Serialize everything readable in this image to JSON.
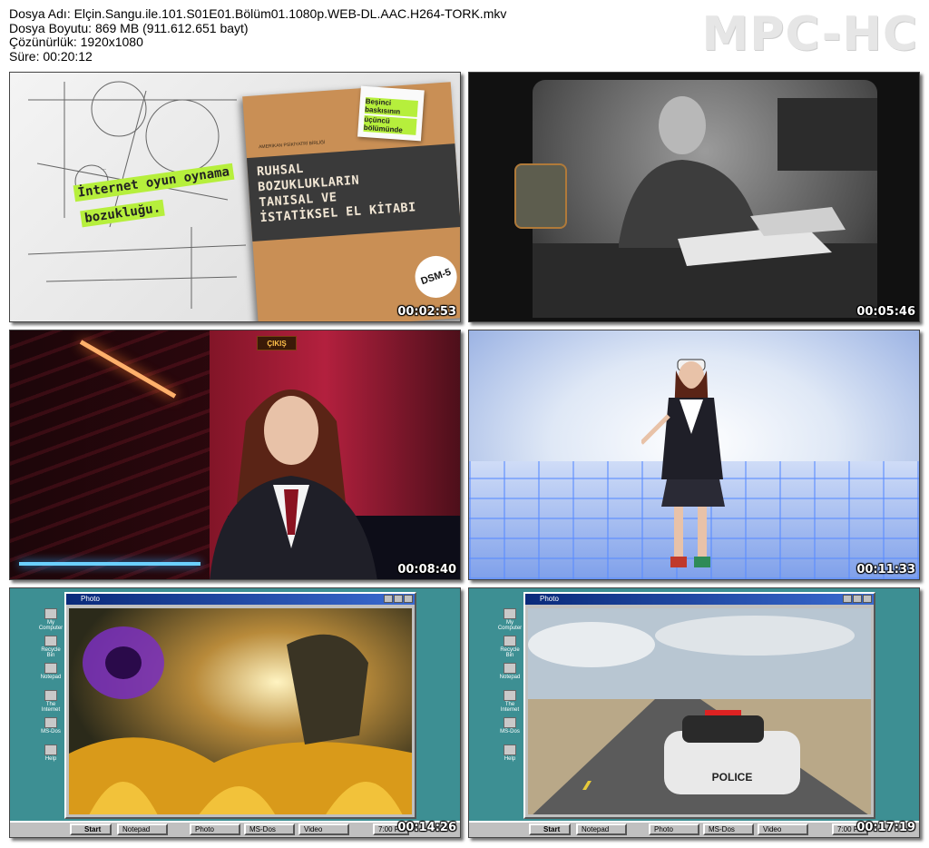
{
  "file_info": {
    "name_line": "Dosya Adı: Elçin.Sangu.ile.101.S01E01.Bölüm01.1080p.WEB-DL.AAC.H264-TORK.mkv",
    "size_line": "Dosya Boyutu: 869 MB (911.612.651 bayt)",
    "resolution_line": "Çözünürlük: 1920x1080",
    "duration_line": "Süre: 00:20:12"
  },
  "logo": "MPC-HC",
  "thumbnails": [
    {
      "timestamp": "00:02:53",
      "sticker_line1": "İnternet oyun oynama",
      "sticker_line2": "bozukluğu.",
      "book_publisher": "AMERİKAN PSİKİYATRİ BİRLİĞİ",
      "book_title_1": "RUHSAL",
      "book_title_2": "BOZUKLUKLARIN",
      "book_title_3": "TANISAL VE",
      "book_title_4": "İSTATİKSEL EL KİTABI",
      "note_line1": "Beşinci baskısının",
      "note_line2": "üçüncü bölümünde",
      "badge": "DSM-5"
    },
    {
      "timestamp": "00:05:46"
    },
    {
      "timestamp": "00:08:40",
      "sign": "ÇIKIŞ"
    },
    {
      "timestamp": "00:11:33"
    },
    {
      "timestamp": "00:14:26",
      "window_title": "Photo",
      "start_label": "Start",
      "task_1": "Notepad",
      "task_2": "Photo",
      "task_3": "MS-Dos",
      "task_4": "Video",
      "clock": "7:00 PM",
      "desktop_icons": [
        "My Computer",
        "Recycle Bin",
        "Notepad",
        "The Internet",
        "MS-Dos",
        "Help"
      ]
    },
    {
      "timestamp": "00:17:19",
      "window_title": "Photo",
      "start_label": "Start",
      "task_1": "Notepad",
      "task_2": "Photo",
      "task_3": "MS-Dos",
      "task_4": "Video",
      "clock": "7:00 PM",
      "desktop_icons": [
        "My Computer",
        "Recycle Bin",
        "Notepad",
        "The Internet",
        "MS-Dos",
        "Help"
      ],
      "car_text": "POLICE"
    }
  ]
}
